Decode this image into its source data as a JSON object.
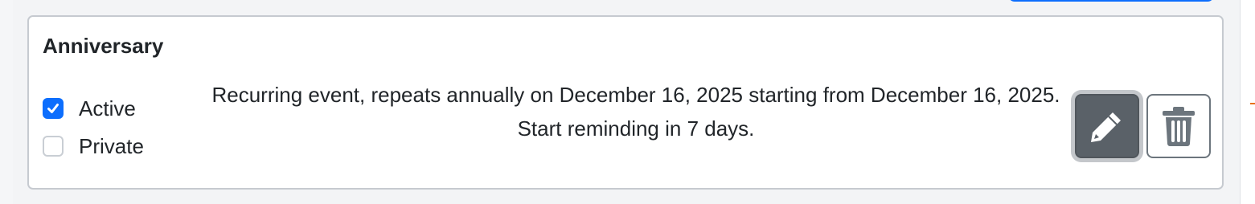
{
  "event": {
    "title": "Anniversary",
    "options": [
      {
        "label": "Active",
        "checked": true
      },
      {
        "label": "Private",
        "checked": false
      }
    ],
    "description_line1": "Recurring event, repeats annually on December 16, 2025 starting from December 16, 2025.",
    "description_line2": "Start reminding in 7 days."
  },
  "actions": {
    "edit_icon": "pencil-icon",
    "delete_icon": "trash-icon"
  },
  "colors": {
    "checkbox_checked": "#0d6efd",
    "edit_button": "#5a6168",
    "delete_button_border": "#6c757d",
    "card_border": "#c6cad0"
  }
}
